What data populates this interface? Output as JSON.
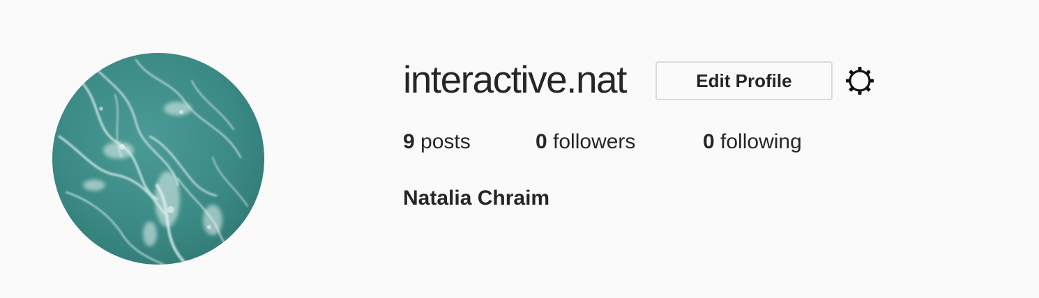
{
  "profile": {
    "username": "interactive.nat",
    "edit_button_label": "Edit Profile",
    "settings_icon": "gear-icon",
    "full_name": "Natalia Chraim",
    "avatar_image": "ocean-waves-aerial-photo"
  },
  "stats": {
    "posts_count": "9",
    "posts_label": "posts",
    "followers_count": "0",
    "followers_label": "followers",
    "following_count": "0",
    "following_label": "following"
  },
  "colors": {
    "background": "#fafafa",
    "text": "#262626",
    "button_border": "#dbdbdb",
    "avatar_water": "#3d8f8a",
    "avatar_foam": "#e6f3f1"
  }
}
